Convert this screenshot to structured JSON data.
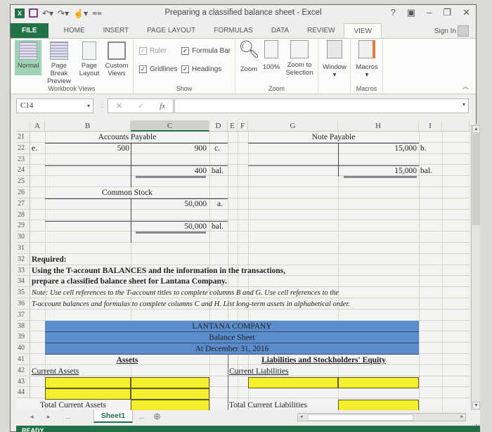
{
  "window": {
    "title": "Preparing a classified balance sheet - Excel",
    "controls": {
      "help": "?",
      "ribbon_display": "▣",
      "minimize": "–",
      "restore": "❐",
      "close": "✕"
    }
  },
  "ribbon_tabs": [
    "FILE",
    "HOME",
    "INSERT",
    "PAGE LAYOUT",
    "FORMULAS",
    "DATA",
    "REVIEW",
    "VIEW"
  ],
  "active_tab": "VIEW",
  "sign_in": "Sign In",
  "ribbon": {
    "workbook_views": {
      "label": "Workbook Views",
      "buttons": [
        {
          "label1": "Normal",
          "label2": "",
          "active": true
        },
        {
          "label1": "Page Break",
          "label2": "Preview"
        },
        {
          "label1": "Page",
          "label2": "Layout"
        },
        {
          "label1": "Custom",
          "label2": "Views"
        }
      ]
    },
    "show": {
      "label": "Show",
      "checkboxes": [
        {
          "label": "Ruler",
          "checked": true,
          "disabled": true
        },
        {
          "label": "Formula Bar",
          "checked": true
        },
        {
          "label": "Gridlines",
          "checked": true
        },
        {
          "label": "Headings",
          "checked": true
        }
      ]
    },
    "zoom": {
      "label": "Zoom",
      "buttons": [
        {
          "label1": "Zoom",
          "label2": ""
        },
        {
          "label1": "100%",
          "label2": ""
        },
        {
          "label1": "Zoom to",
          "label2": "Selection"
        }
      ]
    },
    "window": {
      "label1": "Window",
      "label2": "▾"
    },
    "macros": {
      "label": "Macros",
      "button1": "Macros",
      "button2": "▾"
    }
  },
  "formula_bar": {
    "name_box": "C14",
    "cancel": "✕",
    "enter": "✓",
    "fx": "fx",
    "value": ""
  },
  "columns": [
    "A",
    "B",
    "C",
    "D",
    "E",
    "F",
    "G",
    "H",
    "I"
  ],
  "selected_column": "C",
  "rows": [
    "21",
    "22",
    "23",
    "24",
    "25",
    "26",
    "27",
    "28",
    "29",
    "30",
    "31",
    "32",
    "33",
    "34",
    "35",
    "36",
    "37",
    "38",
    "39",
    "40",
    "41",
    "42",
    "43",
    "44"
  ],
  "t_accounts": {
    "accounts_payable": {
      "title": "Accounts Payable",
      "debit": [
        {
          "ref": "e.",
          "amount": "500"
        }
      ],
      "credit": [
        {
          "amount": "900",
          "ref": "c."
        }
      ],
      "balance": {
        "amount": "400",
        "ref": "bal."
      }
    },
    "note_payable": {
      "title": "Note Payable",
      "credit": [
        {
          "amount": "15,000",
          "ref": "b."
        }
      ],
      "balance": {
        "amount": "15,000",
        "ref": "bal."
      }
    },
    "common_stock": {
      "title": "Common Stock",
      "credit": [
        {
          "amount": "50,000",
          "ref": "a."
        }
      ],
      "balance": {
        "amount": "50,000",
        "ref": "bal."
      }
    }
  },
  "instructions": {
    "required": "Required:",
    "line1": "Using the T-account BALANCES and the information in the transactions,",
    "line2": "prepare a classified balance sheet for Lantana Company.",
    "note1": "Note: Use cell references to the T-account titles to complete columns B and G.  Use cell references to the",
    "note2": "T-account balances and formulas to complete columns C and H.  List long-term assets in alphabetical order."
  },
  "balance_sheet": {
    "company": "LANTANA COMPANY",
    "statement": "Balance Sheet",
    "date": "At December 31, 2016",
    "assets_header": "Assets",
    "liab_header": "Liabilities and Stockholders' Equity",
    "current_assets": "Current Assets",
    "current_liabilities": "Current Liabilities",
    "total_current_assets": "Total Current Assets",
    "total_current_liabilities": "Total Current Liabilities",
    "input_color": "#f4ee2c",
    "header_color": "#5b8ccb"
  },
  "sheet_tabs": {
    "prev": "◂",
    "next": "▸",
    "more_left": "...",
    "active": "Sheet1",
    "more_right": "...",
    "add": "⊕"
  },
  "status": "READY"
}
